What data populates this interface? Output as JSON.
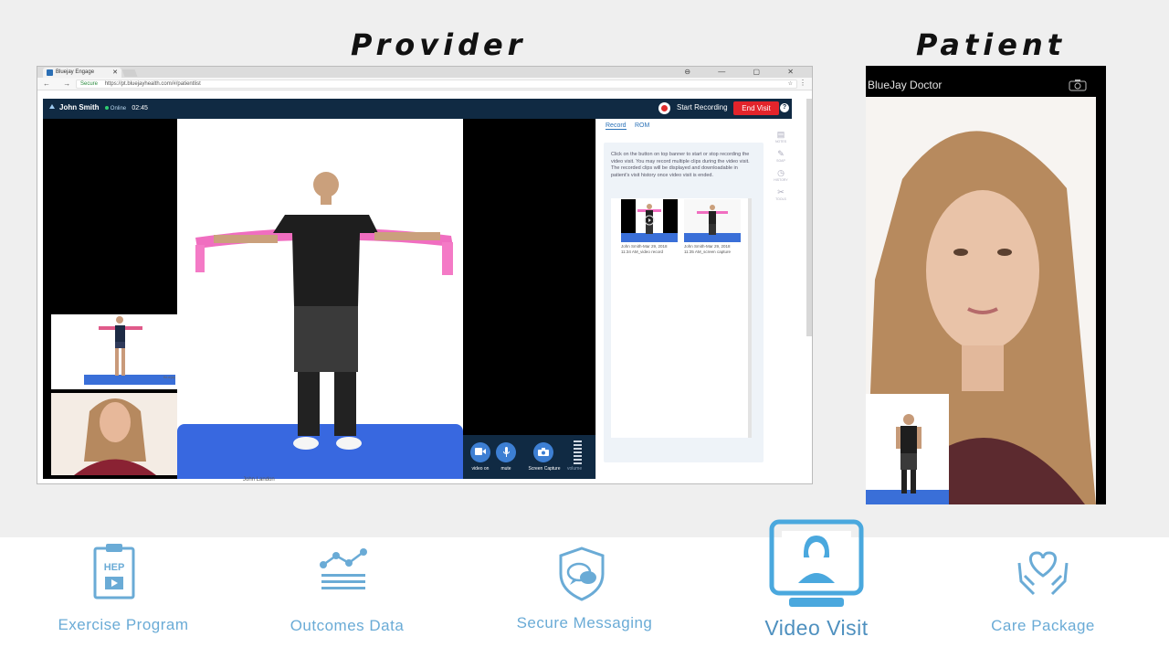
{
  "headings": {
    "provider": "Provider",
    "patient": "Patient"
  },
  "browser": {
    "tab_title": "Bluejay Engage",
    "tab_close": "✕",
    "nav_icons": "← → ⟳",
    "secure_label": "Secure",
    "url": "https://pt.bluejayhealth.com/#/patientlist",
    "window_controls": "⊖ — ▢ ✕",
    "star": "☆",
    "menu": "⋮"
  },
  "visit": {
    "patient_name": "John Smith",
    "status": "Online",
    "timer": "02:45",
    "start_recording": "Start Recording",
    "end_visit": "End Visit",
    "help": "?",
    "below_name": "John Landon"
  },
  "controls": {
    "video_on": "video on",
    "mute": "mute",
    "screen_capture": "Screen Capture",
    "volume": "volume"
  },
  "panel": {
    "tabs": [
      "Record",
      "ROM"
    ],
    "info": "Click on the button on top banner to start or stop recording the video visit. You may record multiple clips during the video visit. The recorded clips will be displayed and downloadable in patient's visit history once video visit is ended.",
    "clips": [
      {
        "line1": "John Smith-Mar 29, 2018",
        "line2": "11:34 AM_video record"
      },
      {
        "line1": "John Smith-Mar 29, 2018",
        "line2": "11:35 AM_screen capture"
      }
    ],
    "sidebar": [
      "NOTES",
      "SOAP",
      "HISTORY",
      "TOOLS"
    ],
    "thumb_label": "Bluejay"
  },
  "patient_app": {
    "title": "BlueJay Doctor"
  },
  "features": [
    {
      "label": "Exercise Program",
      "icon": "clipboard-hep-icon",
      "icon_text": "HEP"
    },
    {
      "label": "Outcomes Data",
      "icon": "chart-trend-icon"
    },
    {
      "label": "Secure Messaging",
      "icon": "shield-chat-icon"
    },
    {
      "label": "Video Visit",
      "icon": "monitor-person-icon"
    },
    {
      "label": "Care Package",
      "icon": "hands-heart-icon"
    }
  ],
  "colors": {
    "accent": "#6aabd6",
    "app_bar": "#102a43",
    "end_visit": "#e3242b",
    "mat_blue": "#3868e0"
  }
}
